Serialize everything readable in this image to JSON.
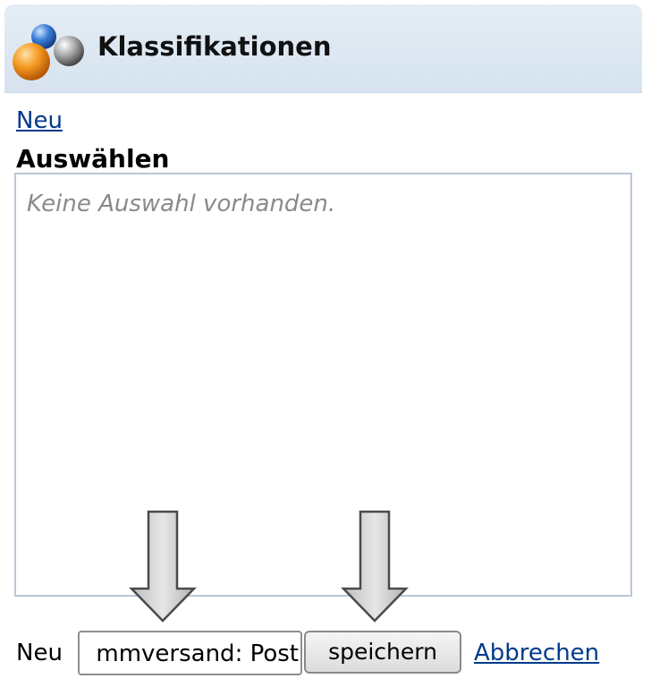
{
  "header": {
    "title": "Klassifikationen",
    "logo_icon": "colored-spheres-icon"
  },
  "links": {
    "new": "Neu",
    "cancel": "Abbrechen"
  },
  "select": {
    "label": "Auswählen",
    "empty_text": "Keine Auswahl vorhanden."
  },
  "form": {
    "label": "Neu",
    "input_value": "mmversand: Post",
    "save_label": "speichern"
  },
  "annotations": {
    "arrow_icon": "down-arrow-icon",
    "arrow_color": "#c9c9c9"
  }
}
